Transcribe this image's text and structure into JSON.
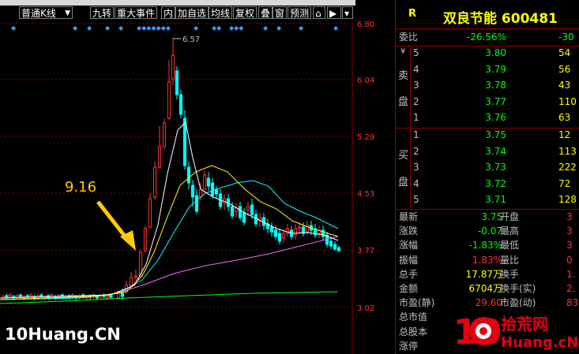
{
  "toolbar": {
    "kline_type": "普通K线",
    "buttons": [
      "九转",
      "重大事件",
      "内",
      "加自选",
      "均线",
      "复权",
      "叠",
      "窗",
      "预测"
    ]
  },
  "chart": {
    "price_labels": [
      "6.80",
      "6.04",
      "5.29",
      "4.53",
      "3.77",
      "3.02"
    ],
    "peak_label": "6.57",
    "annotation": "9.16",
    "colors": {
      "up": "#ff3333",
      "down": "#00ffff",
      "ma5": "#ffffff",
      "ma10": "#ffff00",
      "ma20": "#00ffff",
      "ma60": "#ff66ff",
      "ma120": "#00ff00",
      "arrow": "#ffcc00"
    }
  },
  "quote": {
    "marker": "R",
    "name": "双良节能 600481",
    "weibi_label": "委比",
    "weibi_value": "-26.56%",
    "weibi_extra": "-30",
    "sell_label_top": "卖",
    "sell_label_bottom": "盘",
    "buy_label_top": "买",
    "buy_label_bottom": "盘",
    "currency": "¥",
    "sell": [
      {
        "level": "5",
        "price": "3.80",
        "vol": "54"
      },
      {
        "level": "4",
        "price": "3.79",
        "vol": "56"
      },
      {
        "level": "3",
        "price": "3.78",
        "vol": "43"
      },
      {
        "level": "2",
        "price": "3.77",
        "vol": "110"
      },
      {
        "level": "1",
        "price": "3.76",
        "vol": "63"
      }
    ],
    "buy": [
      {
        "level": "1",
        "price": "3.75",
        "vol": "12"
      },
      {
        "level": "2",
        "price": "3.74",
        "vol": "113"
      },
      {
        "level": "3",
        "price": "3.73",
        "vol": "222"
      },
      {
        "level": "4",
        "price": "3.72",
        "vol": "72"
      },
      {
        "level": "5",
        "price": "3.71",
        "vol": "128"
      }
    ],
    "stats": [
      {
        "k": "最新",
        "v": "3.75",
        "k2": "开盘",
        "v2": "3"
      },
      {
        "k": "涨跌",
        "v": "-0.07",
        "k2": "最高",
        "v2": "3"
      },
      {
        "k": "涨幅",
        "v": "-1.83%",
        "k2": "最低",
        "v2": "3"
      },
      {
        "k": "振幅",
        "v": "1.83%",
        "k2": "量比",
        "v2": "0"
      },
      {
        "k": "总手",
        "v": "17.87万",
        "k2": "换手",
        "v2": "1."
      },
      {
        "k": "金额",
        "v": "6704万",
        "k2": "换手(实)",
        "v2": "2."
      },
      {
        "k": "市盈(静)",
        "v": "29.60",
        "k2": "市盈(动)",
        "v2": "83"
      },
      {
        "k": "总市值",
        "v": "",
        "k2": "",
        "v2": ""
      },
      {
        "k": "总股本",
        "v": "",
        "k2": "",
        "v2": ""
      },
      {
        "k": "涨停",
        "v": "",
        "k2": "",
        "v2": ""
      }
    ]
  },
  "watermark": {
    "left": "10Huang.CN",
    "right_big": "10",
    "right_cn": "拾荒网",
    "right_url": "Huang.cN"
  }
}
